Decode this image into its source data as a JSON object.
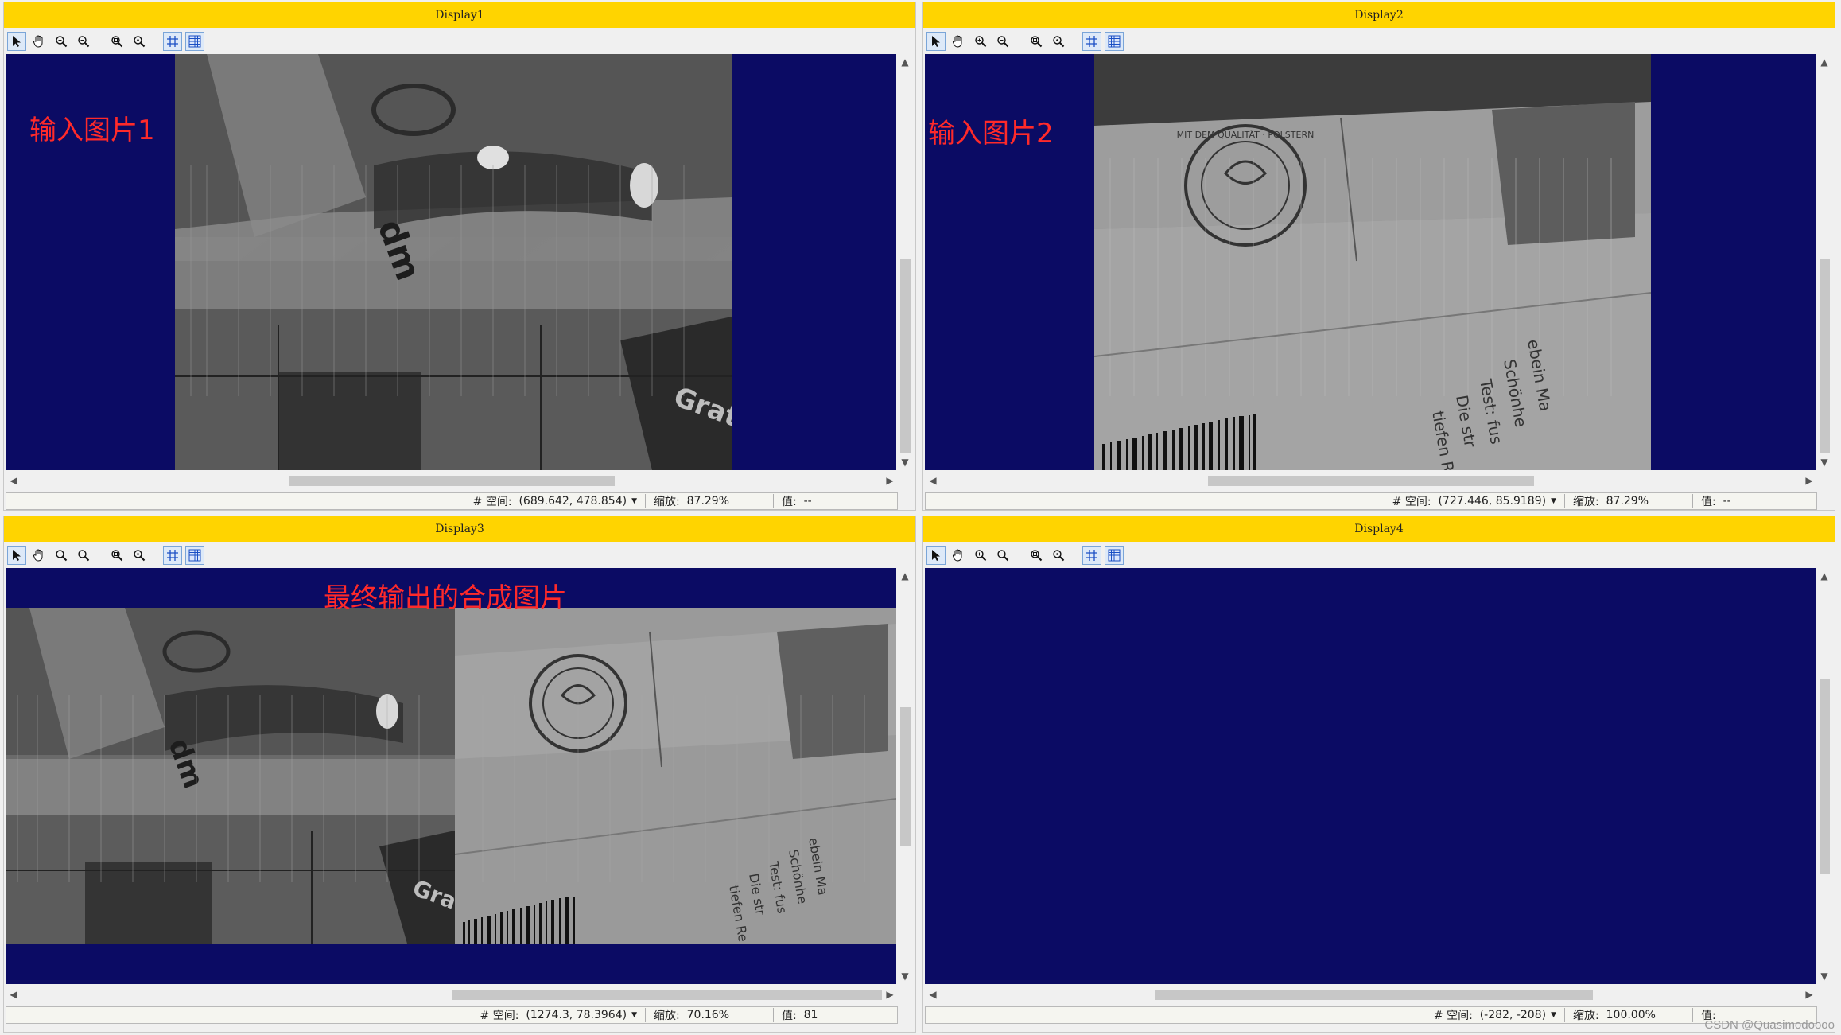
{
  "displays": [
    {
      "title": "Display1",
      "overlay": "输入图片1",
      "status": {
        "space_label": "# 空间:",
        "space_value": "(689.642, 478.854)",
        "zoom_label": "缩放:",
        "zoom_value": "87.29%",
        "value_label": "值:",
        "value": "--"
      }
    },
    {
      "title": "Display2",
      "overlay": "输入图片2",
      "status": {
        "space_label": "# 空间:",
        "space_value": "(727.446, 85.9189)",
        "zoom_label": "缩放:",
        "zoom_value": "87.29%",
        "value_label": "值:",
        "value": "--"
      }
    },
    {
      "title": "Display3",
      "overlay": "最终输出的合成图片",
      "status": {
        "space_label": "# 空间:",
        "space_value": "(1274.3, 78.3964)",
        "zoom_label": "缩放:",
        "zoom_value": "70.16%",
        "value_label": "值:",
        "value": "81"
      }
    },
    {
      "title": "Display4",
      "overlay": "",
      "status": {
        "space_label": "# 空间:",
        "space_value": "(-282, -208)",
        "zoom_label": "缩放:",
        "zoom_value": "100.00%",
        "value_label": "值:",
        "value": ""
      }
    }
  ],
  "toolbar_icons": [
    "pointer-icon",
    "pan-hand-icon",
    "zoom-in-icon",
    "zoom-out-icon",
    "zoom-fit-icon",
    "zoom-reset-icon",
    "grid-icon",
    "pixel-grid-icon"
  ],
  "photo_text": {
    "pack_brand": "dm",
    "pack_word": "Gratis",
    "roll_seal": "MIT DEM QUALITÄT · POLSTERN",
    "roll_text": [
      "ebein Ma",
      "Schönhe",
      "Test: fus",
      "Die str",
      "tiefen Re"
    ]
  },
  "colors": {
    "title_bar": "#ffd400",
    "canvas_bg": "#0b0b64",
    "label_red": "#ff2a2a"
  },
  "watermark": "CSDN @Quasimodoooo"
}
